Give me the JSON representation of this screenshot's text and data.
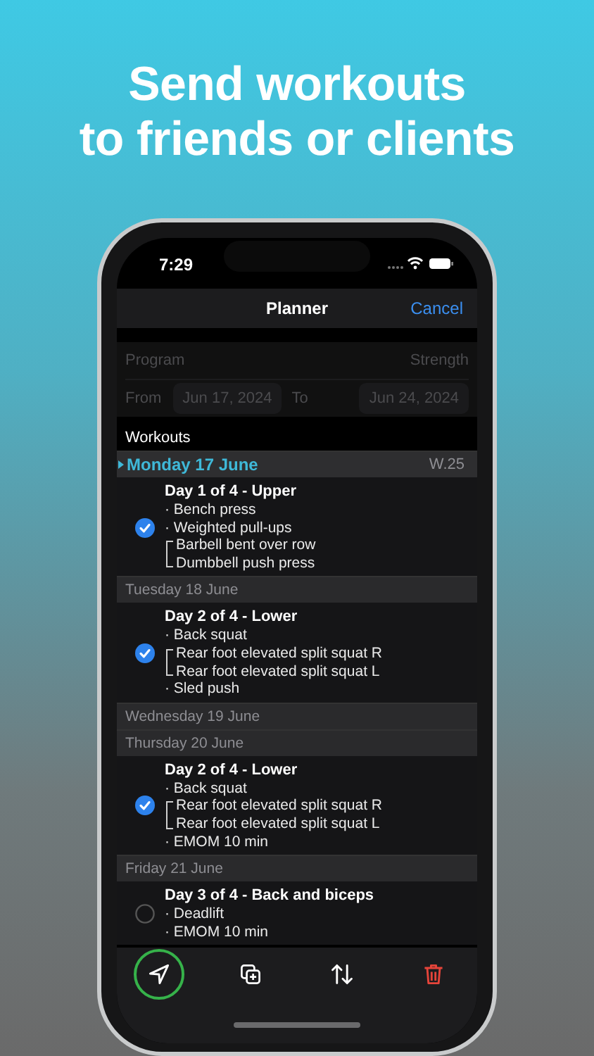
{
  "headline": "Send workouts\nto friends or clients",
  "status_bar": {
    "time": "7:29"
  },
  "nav": {
    "title": "Planner",
    "action": "Cancel"
  },
  "form": {
    "disabled": true,
    "program_label": "Program",
    "program_value": "Strength",
    "from_label": "From",
    "from_date": "Jun 17, 2024",
    "to_label": "To",
    "to_date": "Jun 24, 2024"
  },
  "section_title": "Workouts",
  "days": [
    {
      "label": "Monday 17 June",
      "week": "W.25",
      "selected": true,
      "workouts": [
        {
          "title": "Day 1 of 4 - Upper",
          "checked": true,
          "exercises": [
            {
              "kind": "single",
              "text": "· Bench press"
            },
            {
              "kind": "single",
              "text": "· Weighted pull-ups"
            },
            {
              "kind": "superset",
              "lines": [
                "Barbell bent over row",
                "Dumbbell push press"
              ]
            }
          ]
        }
      ]
    },
    {
      "label": "Tuesday 18 June",
      "selected": false,
      "workouts": [
        {
          "title": "Day 2 of 4 - Lower",
          "checked": true,
          "exercises": [
            {
              "kind": "single",
              "text": "· Back squat"
            },
            {
              "kind": "superset",
              "lines": [
                "Rear foot elevated split squat R",
                "Rear foot elevated split squat L"
              ]
            },
            {
              "kind": "single",
              "text": "· Sled push"
            }
          ]
        }
      ]
    },
    {
      "label": "Wednesday 19 June",
      "selected": false
    },
    {
      "label": "Thursday 20 June",
      "selected": false,
      "workouts": [
        {
          "title": "Day 2 of 4 - Lower",
          "checked": true,
          "exercises": [
            {
              "kind": "single",
              "text": "· Back squat"
            },
            {
              "kind": "superset",
              "lines": [
                "Rear foot elevated split squat R",
                "Rear foot elevated split squat L"
              ]
            },
            {
              "kind": "single",
              "text": "· EMOM 10 min"
            }
          ]
        }
      ]
    },
    {
      "label": "Friday 21 June",
      "selected": false,
      "workouts": [
        {
          "title": "Day 3 of 4 - Back and biceps",
          "checked": false,
          "exercises": [
            {
              "kind": "single",
              "text": "· Deadlift"
            },
            {
              "kind": "single",
              "text": "· EMOM 10 min"
            }
          ]
        }
      ]
    }
  ],
  "toolbar": [
    {
      "kind": "send",
      "highlighted": true
    },
    {
      "kind": "duplicate",
      "highlighted": false
    },
    {
      "kind": "reorder",
      "highlighted": false
    },
    {
      "kind": "delete",
      "highlighted": false
    }
  ]
}
